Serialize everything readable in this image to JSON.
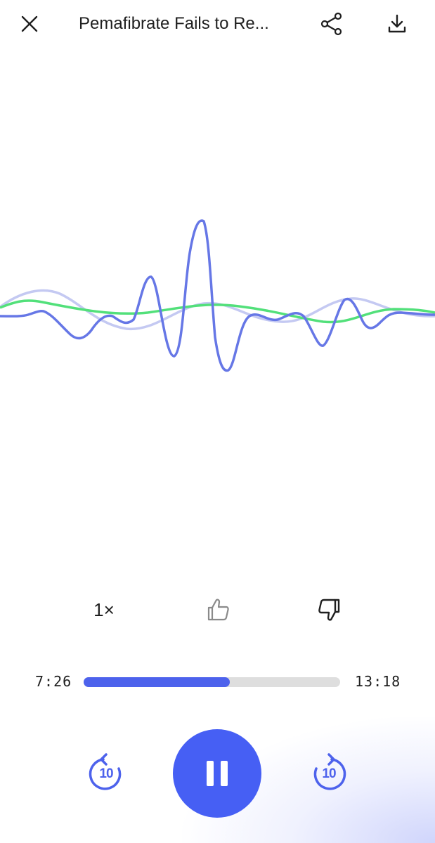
{
  "header": {
    "title": "Pemafibrate Fails to Re...",
    "close_icon": "close-icon",
    "share_icon": "share-icon",
    "download_icon": "download-icon"
  },
  "controls": {
    "speed_label": "1×",
    "like_icon": "thumbs-up-icon",
    "dislike_icon": "thumbs-down-icon"
  },
  "progress": {
    "elapsed": "7:26",
    "remaining": "13:18",
    "fraction": 0.57
  },
  "playback": {
    "state_icon": "pause-icon",
    "rewind_label": "10",
    "forward_label": "10"
  },
  "colors": {
    "accent": "#465ff4",
    "wave_primary": "#6677e6",
    "wave_secondary": "#c4c9f2",
    "wave_green": "#52e07a",
    "track": "#dedede"
  }
}
